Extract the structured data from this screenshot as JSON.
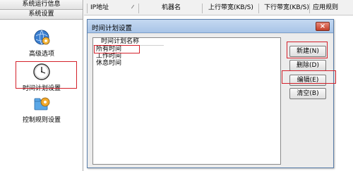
{
  "sidebar": {
    "header": "系统运行信息",
    "subheader": "系统设置",
    "items": [
      {
        "label": "高级选项",
        "icon": "gear-globe-icon"
      },
      {
        "label": "时间计划设置",
        "icon": "clock-icon"
      },
      {
        "label": "控制规则设置",
        "icon": "gear-folder-icon"
      }
    ]
  },
  "table": {
    "columns": [
      "IP地址",
      "机器名",
      "上行带宽(KB/S)",
      "下行带宽(KB/S)",
      "应用规则"
    ]
  },
  "dialog": {
    "title": "时间计划设置",
    "close_label": "×",
    "list_header": "时间计划名称",
    "list_items": [
      "所有时间",
      "工作时间",
      "休息时间"
    ],
    "buttons": {
      "new": "新建(N)",
      "delete": "删除(D)",
      "edit": "编辑(E)",
      "clear": "清空(B)"
    }
  },
  "colors": {
    "highlight": "#d4202a",
    "title_bar": "#b6cfee",
    "close_button": "#c3402b"
  }
}
